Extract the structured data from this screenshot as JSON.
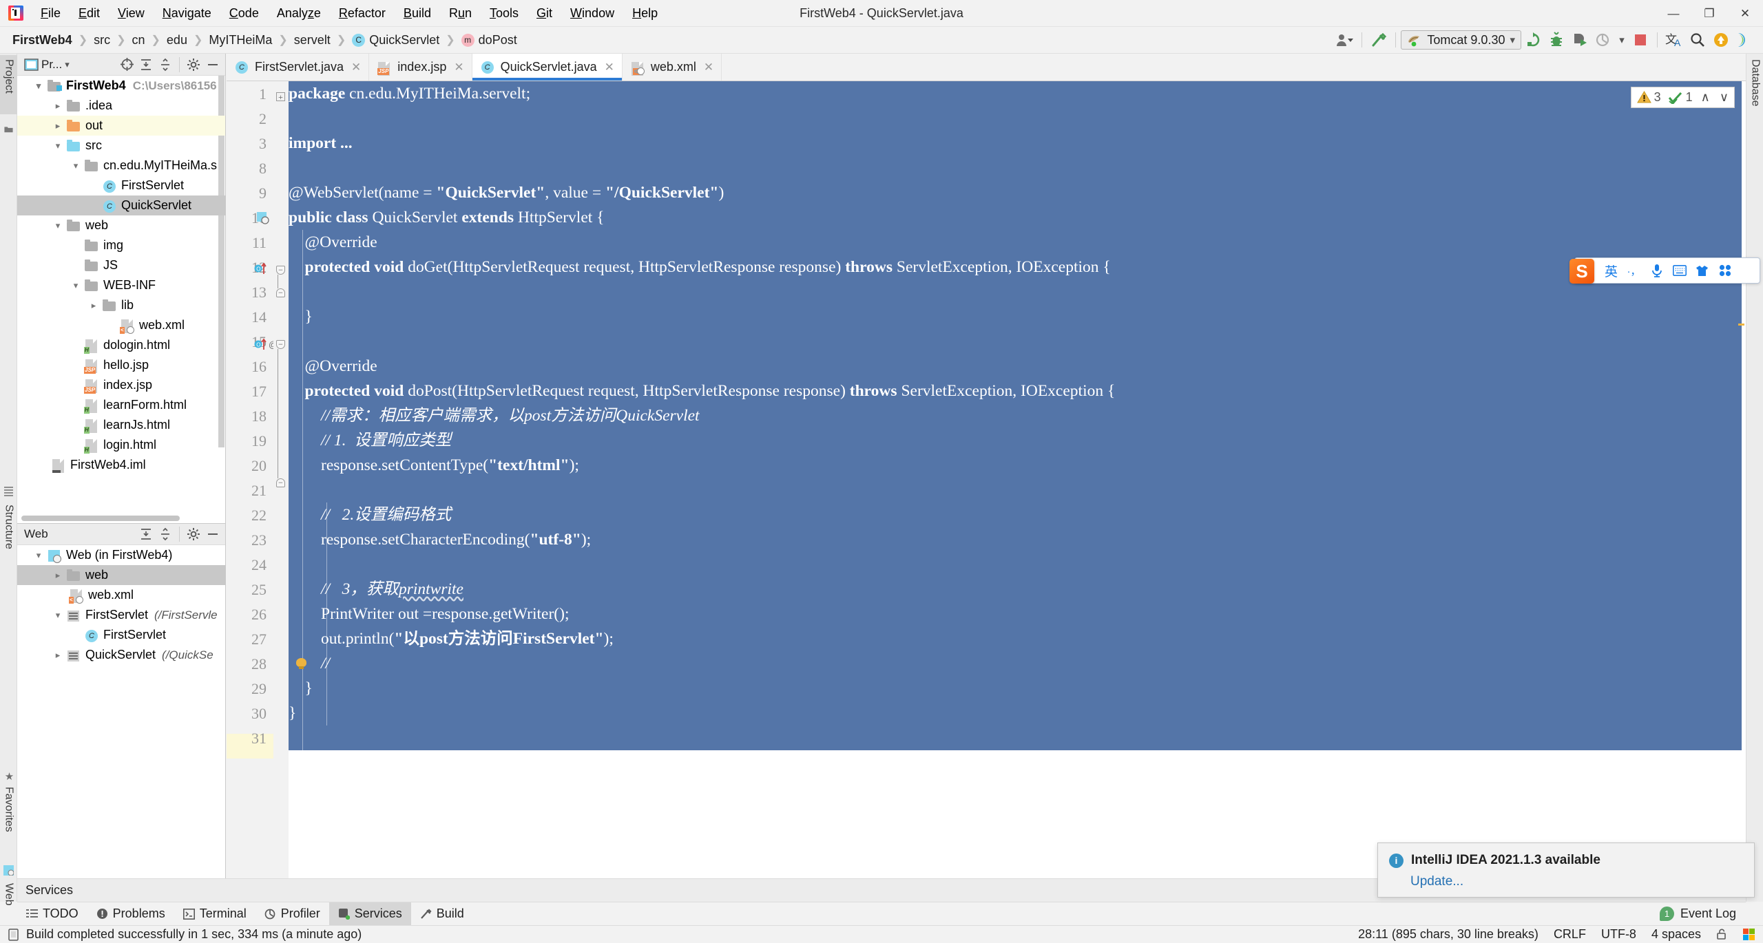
{
  "window": {
    "title": "FirstWeb4 - QuickServlet.java",
    "minimize": "—",
    "maximize": "❐",
    "close": "✕"
  },
  "menubar": [
    {
      "label": "File",
      "mnemonic": "F"
    },
    {
      "label": "Edit",
      "mnemonic": "E"
    },
    {
      "label": "View",
      "mnemonic": "V"
    },
    {
      "label": "Navigate",
      "mnemonic": "N"
    },
    {
      "label": "Code",
      "mnemonic": "C"
    },
    {
      "label": "Analyze",
      "mnemonic": "z"
    },
    {
      "label": "Refactor",
      "mnemonic": "R"
    },
    {
      "label": "Build",
      "mnemonic": "B"
    },
    {
      "label": "Run",
      "mnemonic": "u"
    },
    {
      "label": "Tools",
      "mnemonic": "T"
    },
    {
      "label": "Git",
      "mnemonic": "G"
    },
    {
      "label": "Window",
      "mnemonic": "W"
    },
    {
      "label": "Help",
      "mnemonic": "H"
    }
  ],
  "breadcrumb": [
    {
      "label": "FirstWeb4",
      "icon": "",
      "bold": true
    },
    {
      "label": "src",
      "icon": ""
    },
    {
      "label": "cn",
      "icon": ""
    },
    {
      "label": "edu",
      "icon": ""
    },
    {
      "label": "MyITHeiMa",
      "icon": ""
    },
    {
      "label": "servelt",
      "icon": ""
    },
    {
      "label": "QuickServlet",
      "icon": "class-icon"
    },
    {
      "label": "doPost",
      "icon": "method-icon"
    }
  ],
  "toolbar": {
    "run_config": "Tomcat 9.0.30",
    "icons": [
      "user-settings-icon",
      "build-hammer-icon",
      "rerun-icon",
      "debug-bug-icon",
      "run-with-coverage-icon",
      "profile-icon",
      "stop-icon",
      "translate-icon",
      "search-everywhere-icon",
      "update-project-icon",
      "ide-assistant-icon"
    ]
  },
  "left_strips": {
    "project": "Project",
    "structure": "Structure",
    "favorites": "Favorites",
    "web": "Web"
  },
  "right_strips": {
    "database": "Database"
  },
  "project_panel": {
    "title": "Pr...",
    "header_icons": [
      "select-opened-file-icon",
      "expand-all-icon",
      "collapse-all-icon",
      "gear-icon",
      "hide-icon"
    ],
    "tree": [
      {
        "label": "FirstWeb4",
        "path": "C:\\Users\\86156",
        "depth": 0,
        "arrow": "open",
        "icon": "module-folder",
        "bold": true
      },
      {
        "label": ".idea",
        "depth": 1,
        "arrow": "closed",
        "icon": "folder-gray"
      },
      {
        "label": "out",
        "depth": 1,
        "arrow": "closed",
        "icon": "folder-orange",
        "highlight": true
      },
      {
        "label": "src",
        "depth": 1,
        "arrow": "open",
        "icon": "folder-blue"
      },
      {
        "label": "cn.edu.MyITHeiMa.s",
        "depth": 2,
        "arrow": "open",
        "icon": "package-folder"
      },
      {
        "label": "FirstServlet",
        "depth": 3,
        "arrow": "none",
        "icon": "class-icon"
      },
      {
        "label": "QuickServlet",
        "depth": 3,
        "arrow": "none",
        "icon": "class-icon",
        "selected": true
      },
      {
        "label": "web",
        "depth": 1,
        "arrow": "open",
        "icon": "web-folder"
      },
      {
        "label": "img",
        "depth": 2,
        "arrow": "none",
        "icon": "folder-gray"
      },
      {
        "label": "JS",
        "depth": 2,
        "arrow": "none",
        "icon": "folder-gray"
      },
      {
        "label": "WEB-INF",
        "depth": 2,
        "arrow": "open",
        "icon": "folder-gray"
      },
      {
        "label": "lib",
        "depth": 3,
        "arrow": "closed",
        "icon": "folder-gray"
      },
      {
        "label": "web.xml",
        "depth": 3,
        "arrow": "none",
        "icon": "xml-file"
      },
      {
        "label": "dologin.html",
        "depth": 2,
        "arrow": "none",
        "icon": "html-file"
      },
      {
        "label": "hello.jsp",
        "depth": 2,
        "arrow": "none",
        "icon": "jsp-file"
      },
      {
        "label": "index.jsp",
        "depth": 2,
        "arrow": "none",
        "icon": "jsp-file"
      },
      {
        "label": "learnForm.html",
        "depth": 2,
        "arrow": "none",
        "icon": "html-file"
      },
      {
        "label": "learnJs.html",
        "depth": 2,
        "arrow": "none",
        "icon": "html-file"
      },
      {
        "label": "login.html",
        "depth": 2,
        "arrow": "none",
        "icon": "html-file"
      },
      {
        "label": "FirstWeb4.iml",
        "depth": 1,
        "arrow": "none",
        "icon": "iml-file"
      }
    ]
  },
  "web_panel": {
    "title": "Web",
    "header_icons": [
      "expand-all-icon",
      "collapse-all-icon",
      "gear-icon",
      "hide-icon"
    ],
    "tree": [
      {
        "label": "Web (in FirstWeb4)",
        "depth": 0,
        "arrow": "open",
        "icon": "web-module"
      },
      {
        "label": "web",
        "depth": 1,
        "arrow": "closed",
        "icon": "web-folder",
        "selected": true
      },
      {
        "label": "web.xml",
        "depth": 2,
        "arrow": "none",
        "icon": "xml-file"
      },
      {
        "label": "FirstServlet",
        "italic": "(/FirstServle",
        "depth": 1,
        "arrow": "open",
        "icon": "servlet-icon"
      },
      {
        "label": "FirstServlet",
        "depth": 2,
        "arrow": "none",
        "icon": "class-icon"
      },
      {
        "label": "QuickServlet",
        "italic": "(/QuickSe",
        "depth": 1,
        "arrow": "closed",
        "icon": "servlet-icon"
      }
    ]
  },
  "editor": {
    "tabs": [
      {
        "label": "FirstServlet.java",
        "icon": "class-icon",
        "active": false
      },
      {
        "label": "index.jsp",
        "icon": "jsp-file",
        "active": false
      },
      {
        "label": "QuickServlet.java",
        "icon": "class-icon",
        "active": true
      },
      {
        "label": "web.xml",
        "icon": "xml-file",
        "active": false
      }
    ],
    "close_glyph": "✕",
    "inspection": {
      "warning_count": "3",
      "ok_count": "1",
      "up_glyph": "∧",
      "down_glyph": "∨"
    },
    "line_numbers": [
      "1",
      "2",
      "3",
      "8",
      "9",
      "10",
      "11",
      "12",
      "13",
      "14",
      "15",
      "16",
      "17",
      "18",
      "19",
      "20",
      "21",
      "22",
      "23",
      "24",
      "25",
      "26",
      "27",
      "28",
      "29",
      "30",
      "31"
    ],
    "code_lines": [
      {
        "n": "1",
        "text": "package cn.edu.MyITHeiMa.servelt;"
      },
      {
        "n": "2",
        "text": ""
      },
      {
        "n": "3",
        "text": "import ..."
      },
      {
        "n": "8",
        "text": ""
      },
      {
        "n": "9",
        "text": "@WebServlet(name = \"QuickServlet\", value = \"/QuickServlet\")"
      },
      {
        "n": "10",
        "text": "public class QuickServlet extends HttpServlet {"
      },
      {
        "n": "11",
        "text": "    @Override"
      },
      {
        "n": "12",
        "text": "    protected void doGet(HttpServletRequest request, HttpServletResponse response) throws ServletException, IOException {"
      },
      {
        "n": "13",
        "text": ""
      },
      {
        "n": "14",
        "text": "    }"
      },
      {
        "n": "15",
        "text": ""
      },
      {
        "n": "16",
        "text": "    @Override"
      },
      {
        "n": "17",
        "text": "    protected void doPost(HttpServletRequest request, HttpServletResponse response) throws ServletException, IOException {"
      },
      {
        "n": "18",
        "text": "        //需求：相应客户端需求，以post方法访问QuickServlet"
      },
      {
        "n": "19",
        "text": "        // 1.  设置响应类型"
      },
      {
        "n": "20",
        "text": "        response.setContentType(\"text/html\");"
      },
      {
        "n": "21",
        "text": ""
      },
      {
        "n": "22",
        "text": "        //   2.设置编码格式"
      },
      {
        "n": "23",
        "text": "        response.setCharacterEncoding(\"utf-8\");"
      },
      {
        "n": "24",
        "text": ""
      },
      {
        "n": "25",
        "text": "        //   3，获取printwrite"
      },
      {
        "n": "26",
        "text": "        PrintWriter out =response.getWriter();"
      },
      {
        "n": "27",
        "text": "        out.println(\"以post方法访问FirstServlet\");"
      },
      {
        "n": "28",
        "text": "        //"
      },
      {
        "n": "29",
        "text": "    }"
      },
      {
        "n": "30",
        "text": "}"
      },
      {
        "n": "31",
        "text": ""
      }
    ]
  },
  "ime": {
    "logo": "S",
    "mode": "英",
    "punct": "·，",
    "icons": [
      "microphone-icon",
      "keyboard-icon",
      "skin-icon",
      "apps-icon"
    ]
  },
  "services_panel": {
    "title": "Services"
  },
  "bottom_tabs": [
    {
      "label": "TODO",
      "icon": "todo-icon",
      "active": false
    },
    {
      "label": "Problems",
      "icon": "problems-icon",
      "active": false
    },
    {
      "label": "Terminal",
      "icon": "terminal-icon",
      "active": false
    },
    {
      "label": "Profiler",
      "icon": "profiler-icon",
      "active": false
    },
    {
      "label": "Services",
      "icon": "services-icon",
      "active": true
    },
    {
      "label": "Build",
      "icon": "build-icon",
      "active": false
    }
  ],
  "event_log": {
    "count": "1",
    "label": "Event Log"
  },
  "statusbar": {
    "message": "Build completed successfully in 1 sec, 334 ms (a minute ago)",
    "caret": "28:11 (895 chars, 30 line breaks)",
    "line_sep": "CRLF",
    "encoding": "UTF-8",
    "indent": "4 spaces",
    "lock": "unlocked-icon"
  },
  "notification": {
    "title": "IntelliJ IDEA 2021.1.3 available",
    "action": "Update..."
  },
  "colors": {
    "selection": "#5475a8",
    "accent": "#2d7bd4",
    "warning": "#edb440",
    "ok": "#59a869",
    "error": "#d9534f",
    "link": "#2470b3"
  }
}
